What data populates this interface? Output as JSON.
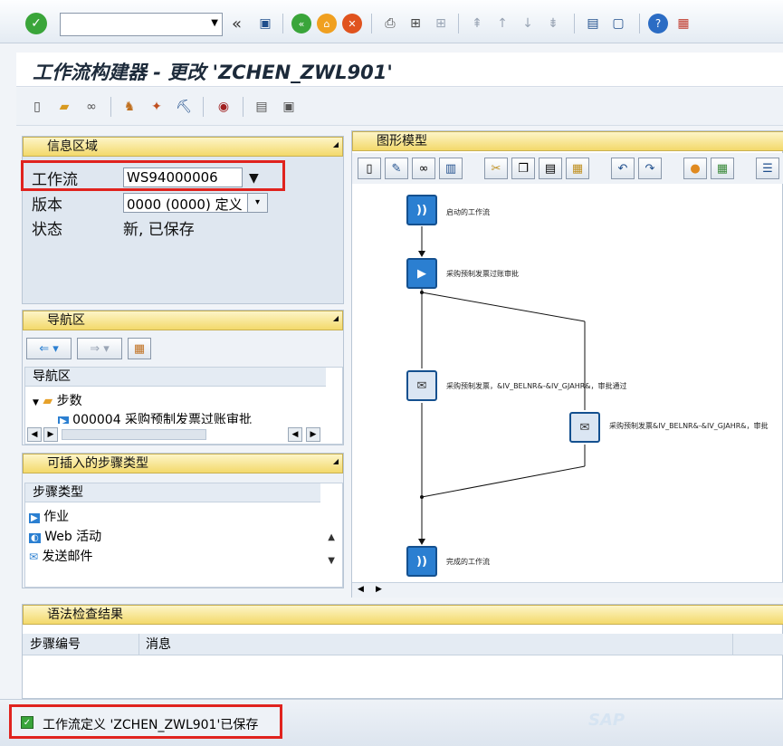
{
  "toolbar": {
    "command_field_value": "",
    "back_symbol": "«"
  },
  "title": "工作流构建器 - 更改 'ZCHEN_ZWL901'",
  "info_panel": {
    "header": "信息区域",
    "workflow_label": "工作流",
    "workflow_value": "WS94000006",
    "version_label": "版本",
    "version_value": "0000 (0000) 定义",
    "status_label": "状态",
    "status_value": "新, 已保存"
  },
  "nav_panel": {
    "header": "导航区",
    "column_header": "导航区",
    "tree_root": "步数",
    "tree_child": "000004 采购预制发票过账审批"
  },
  "step_panel": {
    "header": "可插入的步骤类型",
    "column_header": "步骤类型",
    "items": [
      "作业",
      "Web 活动",
      "发送邮件"
    ]
  },
  "graphic_panel": {
    "header": "图形模型",
    "nodes": {
      "start": "启动的工作流",
      "activity": "采购预制发票过账审批",
      "mail1": "采购预制发票，&IV_BELNR&-&IV_GJAHR&，审批通过",
      "mail2": "采购预制发票&IV_BELNR&-&IV_GJAHR&，审批",
      "end": "完成的工作流"
    }
  },
  "syntax_panel": {
    "header": "语法检查结果",
    "col_step": "步骤编号",
    "col_msg": "消息"
  },
  "status_bar": {
    "message": "工作流定义 'ZCHEN_ZWL901'已保存",
    "logo": "SAP"
  },
  "colors": {
    "accent_red": "#e0231e",
    "node_blue": "#2b7fd1",
    "panel_yellow": "#f3d96b"
  }
}
